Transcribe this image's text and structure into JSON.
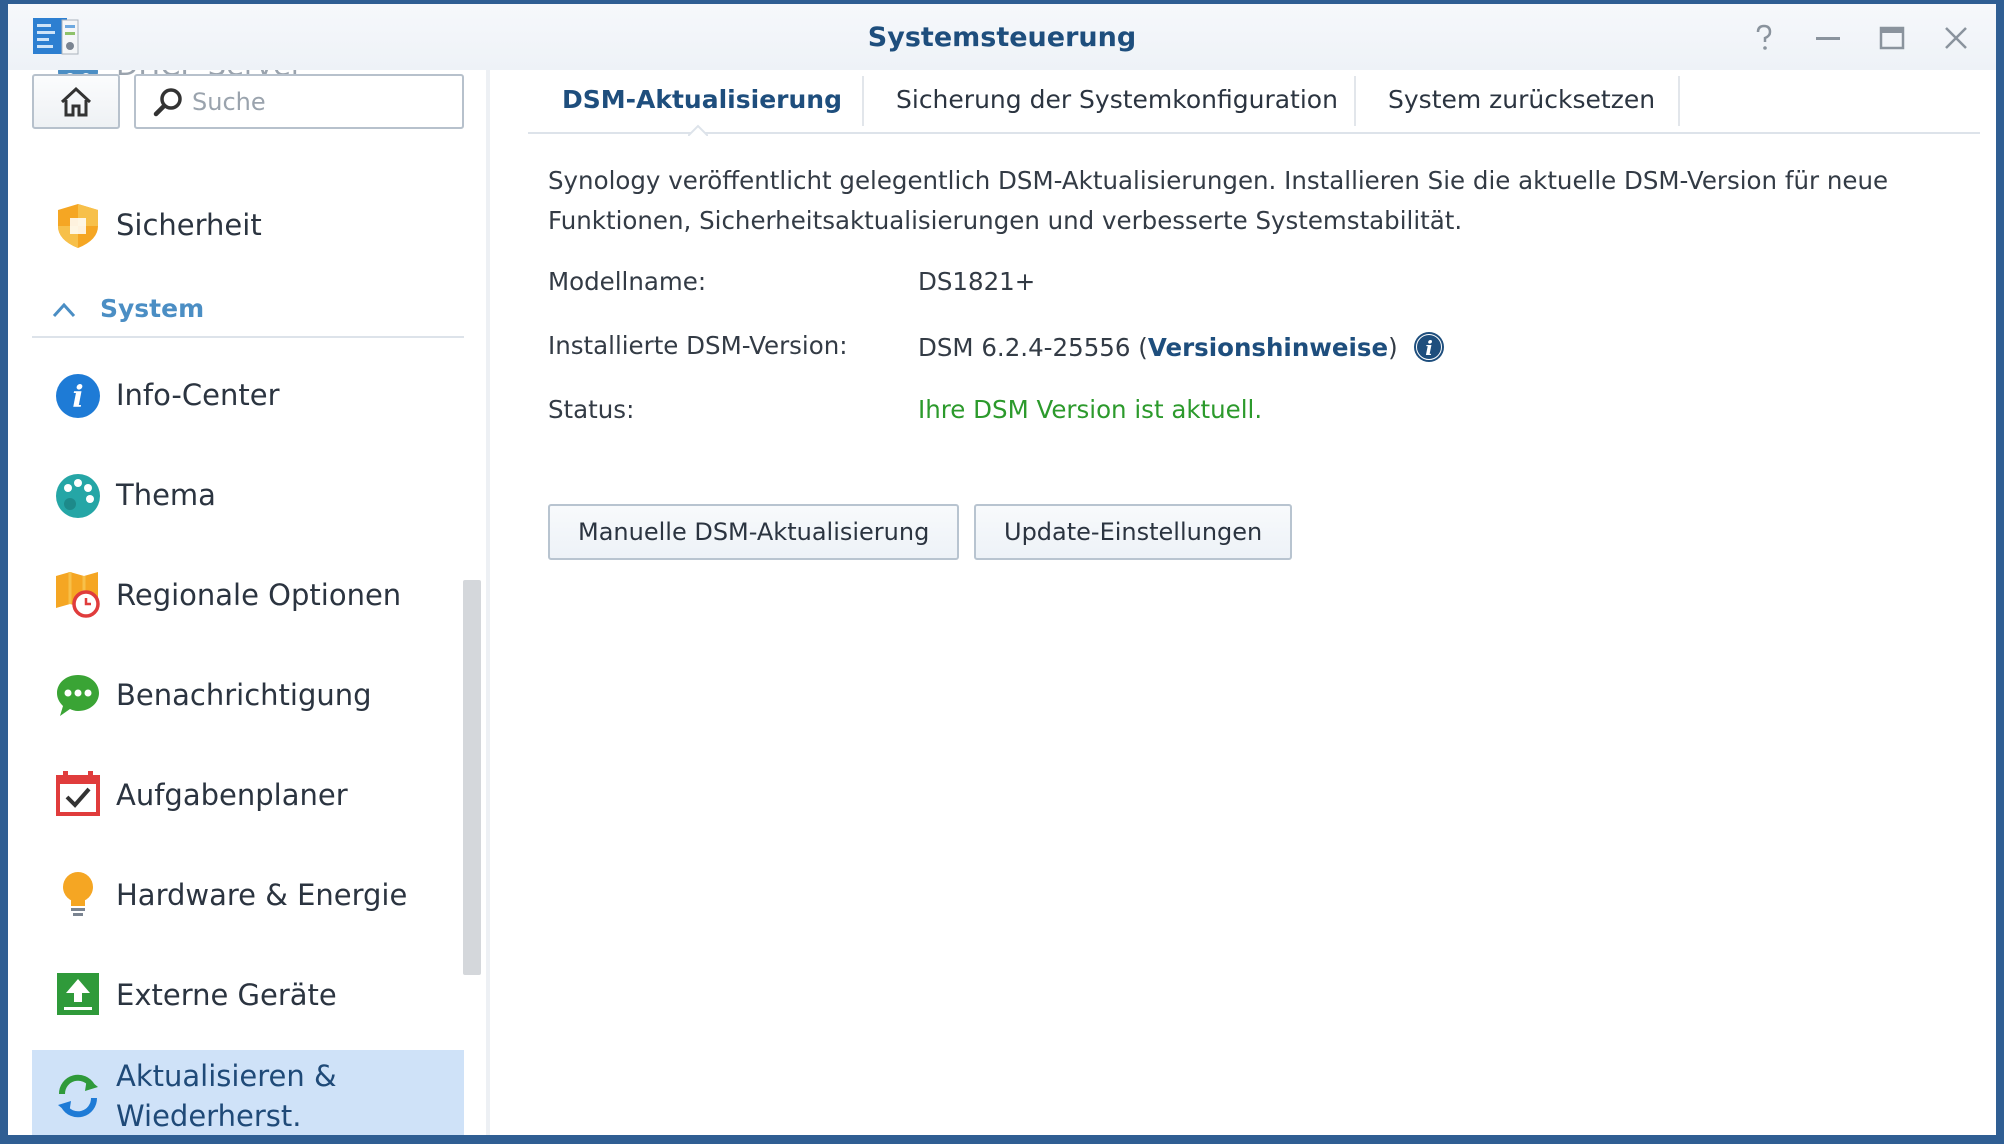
{
  "window": {
    "title": "Systemsteuerung"
  },
  "search": {
    "placeholder": "Suche"
  },
  "sidebar": {
    "partial_item_label": "DHCP-Server",
    "security_label": "Sicherheit",
    "group_label": "System",
    "items": [
      {
        "label": "Info-Center",
        "icon": "info-center-icon"
      },
      {
        "label": "Thema",
        "icon": "palette-icon"
      },
      {
        "label": "Regionale Optionen",
        "icon": "regional-options-icon"
      },
      {
        "label": "Benachrichtigung",
        "icon": "notification-icon"
      },
      {
        "label": "Aufgabenplaner",
        "icon": "task-scheduler-icon"
      },
      {
        "label": "Hardware & Energie",
        "icon": "lightbulb-icon"
      },
      {
        "label": "Externe Geräte",
        "icon": "external-devices-icon"
      }
    ],
    "active_item": {
      "label_line1": "Aktualisieren &",
      "label_line2": "Wiederherst."
    }
  },
  "tabs": [
    "DSM-Aktualisierung",
    "Sicherung der Systemkonfiguration",
    "System zurücksetzen"
  ],
  "main": {
    "description_line1": "Synology veröffentlicht gelegentlich DSM-Aktualisierungen. Installieren Sie die aktuelle DSM-Version für neue",
    "description_line2": "Funktionen, Sicherheitsaktualisierungen und verbesserte Systemstabilität.",
    "model_label": "Modellname:",
    "model_value": "DS1821+",
    "version_label": "Installierte DSM-Version:",
    "version_value": "DSM 6.2.4-25556",
    "release_notes_link": "Versionshinweise",
    "status_label": "Status:",
    "status_value": "Ihre DSM Version ist aktuell.",
    "manual_update_button": "Manuelle DSM-Aktualisierung",
    "update_settings_button": "Update-Einstellungen"
  },
  "colors": {
    "accent": "#1e4e7d",
    "status_ok": "#2c9a2c",
    "active_bg": "#cfe2f8",
    "frame": "#2f5e93"
  }
}
